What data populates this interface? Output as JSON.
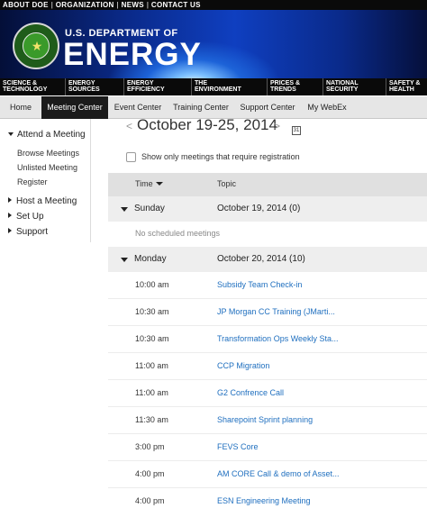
{
  "utility_nav": [
    "ABOUT DOE",
    "ORGANIZATION",
    "NEWS",
    "CONTACT US"
  ],
  "utility_separator": "|",
  "banner": {
    "department": "U.S. DEPARTMENT OF",
    "name": "ENERGY",
    "seal_alt": "Department of Energy seal"
  },
  "categories": [
    "SCIENCE &\nTECHNOLOGY",
    "ENERGY\nSOURCES",
    "ENERGY\nEFFICIENCY",
    "THE\nENVIRONMENT",
    "PRICES &\nTRENDS",
    "NATIONAL\nSECURITY",
    "SAFETY &\nHEALTH"
  ],
  "tabs": [
    "Home",
    "Meeting Center",
    "Event Center",
    "Training Center",
    "Support Center",
    "My WebEx"
  ],
  "active_tab": "Meeting Center",
  "sidebar": {
    "attend": "Attend a Meeting",
    "attend_subitems": [
      "Browse Meetings",
      "Unlisted Meeting",
      "Register"
    ],
    "host": "Host a Meeting",
    "setup": "Set Up",
    "support": "Support"
  },
  "week_nav": {
    "prev": "<",
    "title": "October 19-25, 2014",
    "next": ">",
    "calendar_day": "31"
  },
  "filter_label": "Show only meetings that require registration",
  "table_header": {
    "time": "Time",
    "topic": "Topic"
  },
  "days": [
    {
      "name": "Sunday",
      "date": "October 19, 2014 (0)",
      "empty_text": "No scheduled meetings"
    },
    {
      "name": "Monday",
      "date": "October 20, 2014 (10)"
    }
  ],
  "meetings": [
    {
      "time": "10:00 am",
      "topic": "Subsidy Team Check-in"
    },
    {
      "time": "10:30 am",
      "topic": "JP Morgan CC Training (JMarti..."
    },
    {
      "time": "10:30 am",
      "topic": "Transformation Ops Weekly Sta..."
    },
    {
      "time": "11:00 am",
      "topic": "CCP Migration"
    },
    {
      "time": "11:00 am",
      "topic": "G2 Confrence Call"
    },
    {
      "time": "11:30 am",
      "topic": "Sharepoint Sprint planning"
    },
    {
      "time": "3:00 pm",
      "topic": "FEVS Core"
    },
    {
      "time": "4:00 pm",
      "topic": "AM CORE Call & demo of Asset..."
    },
    {
      "time": "4:00 pm",
      "topic": "ESN Engineering Meeting"
    }
  ],
  "colors": {
    "link": "#1f6fbf",
    "tab_active_bg": "#1b1b1b",
    "header_bg": "#e0e0e0",
    "day_row_bg": "#eeeeee"
  }
}
